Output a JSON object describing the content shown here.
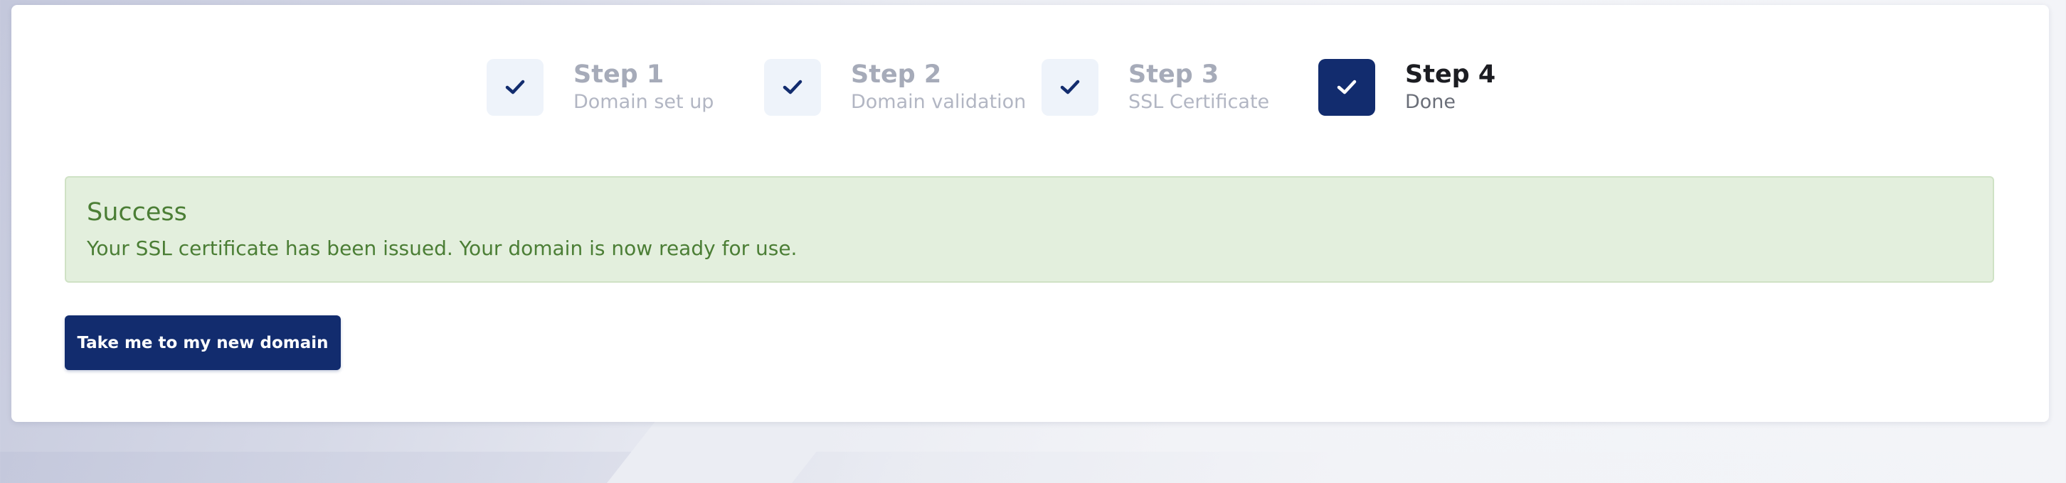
{
  "stepper": {
    "steps": [
      {
        "title": "Step 1",
        "subtitle": "Domain set up",
        "state": "completed",
        "icon": "check-icon"
      },
      {
        "title": "Step 2",
        "subtitle": "Domain validation",
        "state": "completed",
        "icon": "check-icon"
      },
      {
        "title": "Step 3",
        "subtitle": "SSL Certificate",
        "state": "completed",
        "icon": "check-icon"
      },
      {
        "title": "Step 4",
        "subtitle": "Done",
        "state": "active",
        "icon": "check-icon"
      }
    ]
  },
  "alert": {
    "title": "Success",
    "message": "Your SSL certificate has been issued. Your domain is now ready for use."
  },
  "actions": {
    "primary_label": "Take me to my new domain"
  },
  "colors": {
    "brand": "#122c6e",
    "success_text": "#4b7e35",
    "success_bg": "#e3efdd"
  }
}
